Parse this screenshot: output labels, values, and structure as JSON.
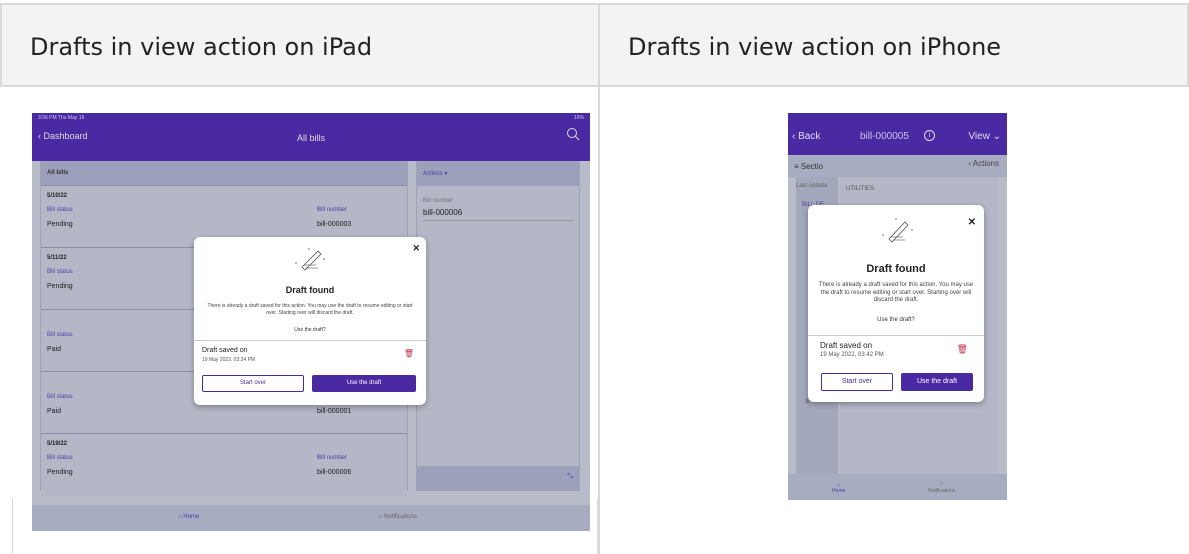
{
  "headers": {
    "ipad": "Drafts in view action on iPad",
    "iphone": "Drafts in view action on iPhone"
  },
  "colors": {
    "brand": "#4a2aa3",
    "link": "#4b3ea8",
    "danger": "#c0304a"
  },
  "ipad": {
    "status_left": "3:56 PM  Thu May 19",
    "status_right": "16%",
    "back_label": "Dashboard",
    "nav_title": "All bills",
    "list_header": "All bills",
    "rows": [
      {
        "date": "5/10/22",
        "status_label": "Bill status",
        "status": "Pending",
        "number_label": "Bill number",
        "number": "bill-000003"
      },
      {
        "date": "5/11/22",
        "status_label": "Bill status",
        "status": "Pending",
        "number_label": "",
        "number": ""
      },
      {
        "date": "",
        "status_label": "Bill status",
        "status": "Paid",
        "number_label": "",
        "number": ""
      },
      {
        "date": "",
        "status_label": "Bill status",
        "status": "Paid",
        "number_label": "",
        "number": "bill-000001"
      },
      {
        "date": "5/19/22",
        "status_label": "Bill status",
        "status": "Pending",
        "number_label": "Bill number",
        "number": "bill-000006"
      }
    ],
    "actions_label": "Actions",
    "side_bill_label": "Bill number",
    "side_bill_value": "bill-000006",
    "tab_home": "Home",
    "tab_notifications": "Notifications"
  },
  "iphone": {
    "back_label": "Back",
    "nav_title": "bill-000005",
    "view_label": "View",
    "sections_label": "Sectio",
    "actions_label": "Actions",
    "last_updated": "Last update",
    "bill_details": "BILL DE",
    "col_e": "E",
    "utilities": "UTILITIES",
    "tab_home": "Home",
    "tab_notifications": "Notifications"
  },
  "modal_ipad": {
    "title": "Draft found",
    "message": "There is already a draft saved for this action. You may use the draft to resume editing or start over. Starting over will discard the draft.",
    "question": "Use the draft?",
    "draft_label": "Draft saved on",
    "draft_date": "19 May 2022, 03:24 PM",
    "start_over": "Start over",
    "use_draft": "Use the draft"
  },
  "modal_iphone": {
    "title": "Draft found",
    "message": "There is already a draft saved for this action. You may use the draft to resume editing or start over. Starting over will discard the draft.",
    "question": "Use the draft?",
    "draft_label": "Draft saved on",
    "draft_date": "19 May 2022, 03:42 PM",
    "start_over": "Start over",
    "use_draft": "Use the draft"
  }
}
